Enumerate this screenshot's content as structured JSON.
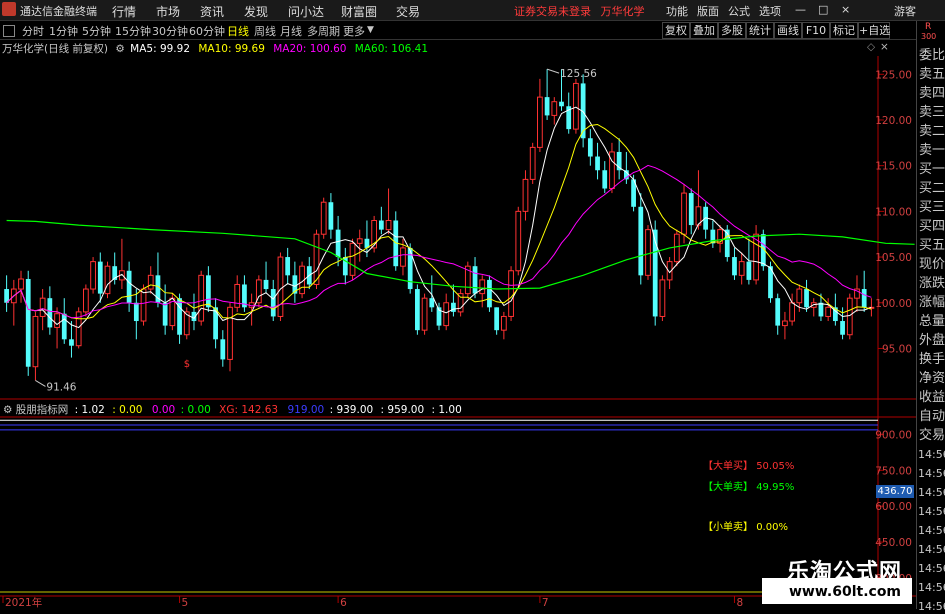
{
  "menubar": {
    "app_name": "通达信金融终端",
    "menus": [
      "行情",
      "市场",
      "资讯",
      "发现",
      "问小达",
      "财富圈",
      "交易"
    ],
    "notice": "证券交易未登录",
    "stock_name": "万华化学",
    "right_menus": [
      "功能",
      "版面",
      "公式",
      "选项"
    ],
    "window_controls": [
      "—",
      "□",
      "×"
    ],
    "guest": "游客"
  },
  "periods": [
    "分时",
    "1分钟",
    "5分钟",
    "15分钟",
    "30分钟",
    "60分钟",
    "日线",
    "周线",
    "月线",
    "多周期",
    "更多"
  ],
  "active_period": "日线",
  "toolbar_right": [
    "复权",
    "叠加",
    "多股",
    "统计",
    "画线",
    "F10",
    "标记",
    "+自选"
  ],
  "chart_header": {
    "title": "万华化学(日线 前复权)",
    "ma5": "MA5: 99.92",
    "ma10": "MA10: 99.69",
    "ma20": "MA20: 100.60",
    "ma60": "MA60: 106.41"
  },
  "sidebar_items": [
    "委比",
    "卖五",
    "卖四",
    "卖三",
    "卖二",
    "卖一",
    "买一",
    "买二",
    "买三",
    "买四",
    "买五",
    "现价",
    "涨跌",
    "涨幅",
    "总量",
    "外盘",
    "换手",
    "净资",
    "收益",
    "自动",
    "交易",
    "14:56",
    "14:56",
    "14:56",
    "14:56",
    "14:56",
    "14:56",
    "14:56",
    "14:56",
    "14:56"
  ],
  "sidebar_top": {
    "r": "R",
    "num": "300"
  },
  "indicator_header": {
    "name": "股朋指标网",
    "v1": ": 1.02",
    "v2": ": 0.00",
    "v3": "0.00",
    "v4": ": 0.00",
    "xg": "XG: 142.63",
    "v5": "919.00",
    "v6": ": 939.00",
    "v7": ": 959.00",
    "v8": ": 1.00"
  },
  "indicator_labels": {
    "big_buy_label": "【大单买】",
    "big_buy_val": "50.05%",
    "big_sell_label": "【大单卖】",
    "big_sell_val": "49.95%",
    "small_sell_label": "【小单卖】",
    "small_sell_val": "0.00%"
  },
  "current_value_tag": "436.70",
  "watermark": {
    "title": "乐淘公式网",
    "url": "www.60lt.com"
  },
  "colors": {
    "up": "#ff3232",
    "down": "#54fcfc",
    "ma5": "#ffffff",
    "ma10": "#ffff00",
    "ma20": "#ff00ff",
    "ma60": "#00ff00"
  },
  "chart_data": {
    "type": "candlestick",
    "x_tick_labels": [
      "2021年",
      "5",
      "6",
      "7",
      "8"
    ],
    "x_tick_index": [
      0,
      24,
      46,
      74,
      101
    ],
    "y_ticks": [
      95,
      100,
      105,
      110,
      115,
      120,
      125
    ],
    "ylim": [
      91,
      127
    ],
    "max_label": "125.56",
    "min_label": "91.46",
    "ohlc": [
      [
        101.5,
        103.0,
        99.0,
        100.0
      ],
      [
        100.0,
        102.5,
        97.5,
        101.5
      ],
      [
        101.5,
        103.5,
        100.0,
        102.6
      ],
      [
        102.6,
        103.5,
        92.0,
        93.0
      ],
      [
        93.0,
        99.0,
        91.5,
        98.5
      ],
      [
        98.5,
        101.5,
        97.0,
        100.5
      ],
      [
        100.5,
        101.8,
        96.5,
        97.3
      ],
      [
        97.3,
        99.5,
        95.0,
        98.8
      ],
      [
        98.8,
        100.5,
        95.5,
        96.0
      ],
      [
        96.0,
        98.0,
        94.0,
        95.3
      ],
      [
        95.3,
        99.5,
        95.0,
        99.0
      ],
      [
        99.0,
        102.0,
        98.5,
        101.5
      ],
      [
        101.5,
        105.0,
        101.0,
        104.5
      ],
      [
        104.5,
        105.5,
        100.0,
        101.0
      ],
      [
        101.0,
        104.5,
        100.5,
        104.0
      ],
      [
        104.0,
        105.5,
        102.0,
        102.5
      ],
      [
        102.5,
        107.0,
        101.5,
        103.5
      ],
      [
        103.5,
        104.5,
        99.0,
        100.0
      ],
      [
        100.0,
        101.5,
        96.0,
        98.0
      ],
      [
        98.0,
        102.0,
        97.5,
        101.5
      ],
      [
        101.5,
        104.0,
        101.0,
        103.0
      ],
      [
        103.0,
        105.5,
        99.5,
        100.0
      ],
      [
        100.0,
        102.0,
        96.5,
        97.5
      ],
      [
        97.5,
        101.0,
        97.0,
        100.5
      ],
      [
        100.5,
        101.0,
        95.5,
        96.5
      ],
      [
        96.5,
        99.5,
        96.0,
        99.0
      ],
      [
        99.0,
        101.0,
        97.0,
        98.0
      ],
      [
        98.0,
        103.5,
        97.5,
        103.0
      ],
      [
        103.0,
        104.0,
        99.0,
        99.5
      ],
      [
        99.5,
        100.5,
        95.0,
        96.0
      ],
      [
        96.0,
        97.0,
        93.0,
        93.8
      ],
      [
        93.8,
        100.0,
        92.5,
        99.5
      ],
      [
        99.5,
        103.0,
        99.0,
        102.0
      ],
      [
        102.0,
        103.0,
        99.0,
        99.5
      ],
      [
        99.5,
        101.0,
        97.5,
        100.0
      ],
      [
        100.0,
        103.0,
        99.5,
        102.5
      ],
      [
        102.5,
        104.5,
        101.0,
        101.5
      ],
      [
        101.5,
        102.5,
        98.0,
        98.5
      ],
      [
        98.5,
        105.5,
        98.0,
        105.0
      ],
      [
        105.0,
        106.0,
        102.0,
        103.0
      ],
      [
        103.0,
        104.5,
        100.0,
        101.0
      ],
      [
        101.0,
        104.5,
        100.5,
        104.0
      ],
      [
        104.0,
        105.0,
        101.5,
        102.0
      ],
      [
        102.0,
        108.0,
        101.5,
        107.5
      ],
      [
        107.5,
        111.5,
        107.0,
        111.0
      ],
      [
        111.0,
        112.0,
        107.0,
        108.0
      ],
      [
        108.0,
        109.5,
        104.0,
        105.0
      ],
      [
        105.0,
        106.0,
        102.0,
        103.0
      ],
      [
        103.0,
        107.0,
        102.5,
        106.5
      ],
      [
        106.5,
        108.0,
        104.5,
        107.0
      ],
      [
        107.0,
        109.0,
        105.0,
        106.0
      ],
      [
        106.0,
        109.5,
        105.5,
        109.0
      ],
      [
        109.0,
        110.5,
        107.5,
        108.0
      ],
      [
        108.0,
        112.5,
        107.5,
        109.0
      ],
      [
        109.0,
        110.0,
        103.5,
        104.0
      ],
      [
        104.0,
        107.0,
        103.0,
        106.0
      ],
      [
        106.0,
        106.5,
        101.0,
        101.5
      ],
      [
        101.5,
        102.0,
        96.5,
        97.0
      ],
      [
        97.0,
        101.0,
        96.5,
        100.5
      ],
      [
        100.5,
        103.0,
        99.0,
        99.5
      ],
      [
        99.5,
        100.0,
        97.0,
        97.5
      ],
      [
        97.5,
        101.0,
        97.0,
        100.0
      ],
      [
        100.0,
        102.0,
        98.5,
        99.0
      ],
      [
        99.0,
        101.5,
        98.5,
        101.0
      ],
      [
        101.0,
        104.5,
        100.5,
        104.0
      ],
      [
        104.0,
        105.0,
        100.5,
        101.0
      ],
      [
        101.0,
        103.0,
        99.5,
        102.5
      ],
      [
        102.5,
        103.0,
        99.0,
        99.5
      ],
      [
        99.5,
        99.5,
        96.5,
        97.0
      ],
      [
        97.0,
        99.0,
        96.0,
        98.5
      ],
      [
        98.5,
        104.0,
        98.0,
        103.5
      ],
      [
        103.5,
        110.5,
        103.0,
        110.0
      ],
      [
        110.0,
        114.5,
        109.0,
        113.5
      ],
      [
        113.5,
        117.5,
        113.0,
        117.0
      ],
      [
        117.0,
        124.5,
        116.5,
        122.5
      ],
      [
        122.5,
        125.56,
        120.0,
        120.5
      ],
      [
        120.5,
        122.5,
        119.5,
        122.0
      ],
      [
        122.0,
        125.56,
        121.0,
        121.5
      ],
      [
        121.5,
        123.0,
        118.5,
        119.0
      ],
      [
        119.0,
        124.5,
        118.5,
        124.0
      ],
      [
        124.0,
        125.0,
        117.0,
        118.0
      ],
      [
        118.0,
        119.0,
        115.0,
        116.0
      ],
      [
        116.0,
        117.5,
        113.5,
        114.5
      ],
      [
        114.5,
        115.5,
        112.0,
        112.5
      ],
      [
        112.5,
        117.5,
        112.0,
        116.5
      ],
      [
        116.5,
        118.0,
        113.5,
        114.5
      ],
      [
        114.5,
        116.5,
        113.0,
        113.5
      ],
      [
        113.5,
        114.0,
        110.0,
        110.5
      ],
      [
        110.5,
        112.0,
        102.0,
        103.0
      ],
      [
        103.0,
        108.5,
        102.5,
        108.0
      ],
      [
        108.0,
        109.0,
        97.5,
        98.5
      ],
      [
        98.5,
        103.0,
        98.0,
        102.5
      ],
      [
        102.5,
        105.0,
        101.5,
        104.5
      ],
      [
        104.5,
        108.0,
        104.0,
        107.5
      ],
      [
        107.5,
        113.0,
        106.5,
        112.0
      ],
      [
        112.0,
        112.5,
        107.5,
        108.5
      ],
      [
        108.5,
        114.5,
        108.0,
        110.5
      ],
      [
        110.5,
        111.0,
        107.0,
        108.0
      ],
      [
        108.0,
        109.0,
        106.0,
        106.5
      ],
      [
        106.5,
        108.5,
        105.5,
        108.0
      ],
      [
        108.0,
        108.5,
        104.5,
        105.0
      ],
      [
        105.0,
        106.0,
        102.5,
        103.0
      ],
      [
        103.0,
        105.5,
        102.0,
        104.5
      ],
      [
        104.5,
        107.0,
        102.0,
        102.5
      ],
      [
        102.5,
        108.5,
        102.0,
        107.5
      ],
      [
        107.5,
        108.0,
        103.5,
        104.0
      ],
      [
        104.0,
        104.5,
        100.0,
        100.5
      ],
      [
        100.5,
        101.0,
        96.5,
        97.5
      ],
      [
        97.5,
        99.0,
        96.0,
        98.0
      ],
      [
        98.0,
        101.0,
        97.5,
        100.0
      ],
      [
        100.0,
        102.0,
        99.0,
        101.5
      ],
      [
        101.5,
        102.5,
        99.0,
        99.5
      ],
      [
        99.5,
        100.5,
        98.5,
        100.0
      ],
      [
        100.0,
        101.0,
        98.0,
        98.5
      ],
      [
        98.5,
        100.5,
        98.0,
        99.5
      ],
      [
        99.5,
        101.0,
        97.5,
        98.0
      ],
      [
        98.0,
        99.5,
        96.0,
        96.5
      ],
      [
        96.5,
        101.0,
        96.0,
        100.5
      ],
      [
        100.5,
        103.0,
        99.0,
        101.5
      ],
      [
        101.5,
        103.5,
        99.0,
        99.5
      ],
      [
        99.5,
        100.5,
        98.5,
        99.5
      ]
    ],
    "ma60_points": [
      [
        0,
        109
      ],
      [
        4,
        108.9
      ],
      [
        10,
        108.5
      ],
      [
        20,
        108.0
      ],
      [
        30,
        107.6
      ],
      [
        40,
        107.0
      ],
      [
        45,
        105.5
      ],
      [
        50,
        103.2
      ],
      [
        56,
        102.3
      ],
      [
        62,
        101.8
      ],
      [
        68,
        101.5
      ],
      [
        74,
        101.6
      ],
      [
        80,
        103.0
      ],
      [
        86,
        104.7
      ],
      [
        92,
        106.0
      ],
      [
        98,
        106.8
      ],
      [
        104,
        107.3
      ],
      [
        110,
        107.5
      ],
      [
        116,
        107.2
      ],
      [
        122,
        106.5
      ],
      [
        126,
        106.4
      ]
    ],
    "volume_ticks": [
      300,
      450,
      600,
      750,
      900
    ],
    "volume_ylim": [
      250,
      960
    ]
  }
}
